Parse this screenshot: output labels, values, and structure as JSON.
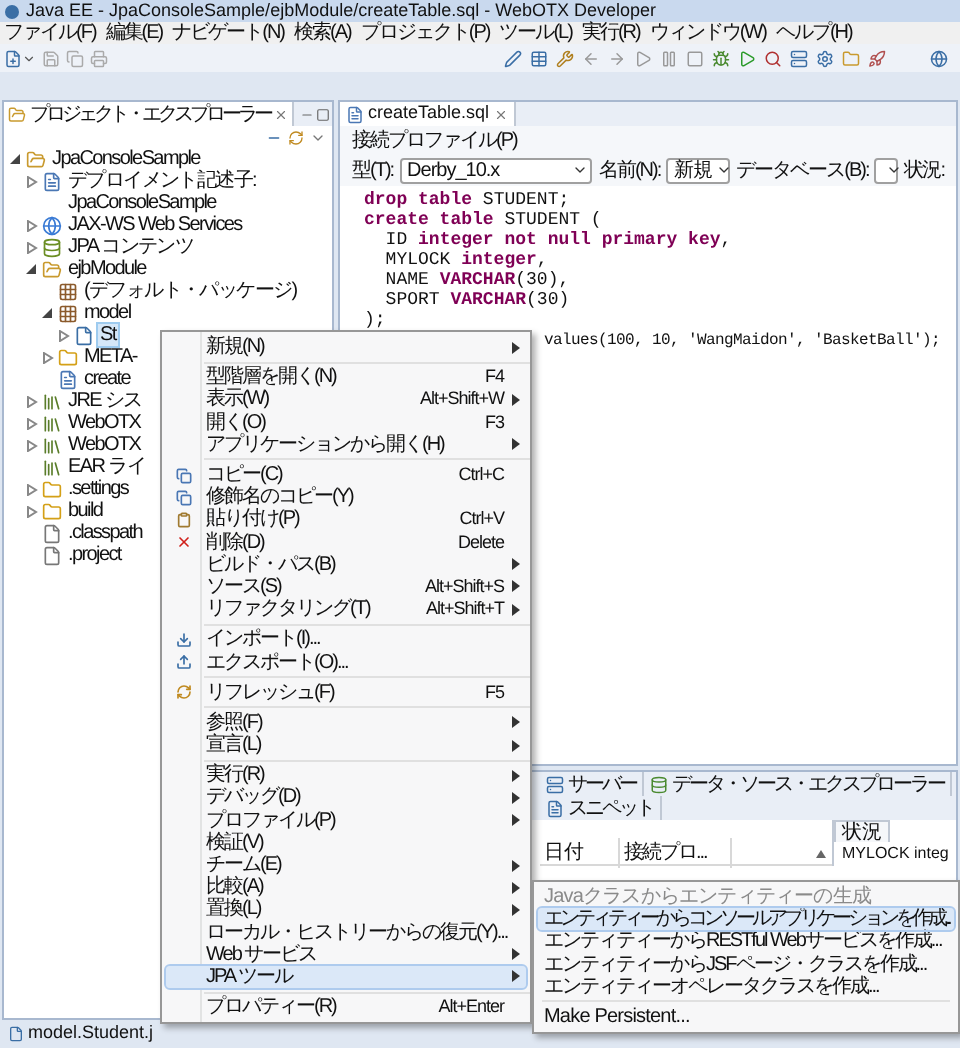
{
  "window": {
    "title": "Java EE - JpaConsoleSample/ejbModule/createTable.sql - WebOTX Developer"
  },
  "menu_bar": [
    "ファイル(F)",
    "編集(E)",
    "ナビゲート(N)",
    "検索(A)",
    "プロジェクト(P)",
    "ツール(L)",
    "実行(R)",
    "ウィンドウ(W)",
    "ヘルプ(H)"
  ],
  "explorer": {
    "title": "プロジェクト・エクスプローラー",
    "tree": [
      {
        "label": "JpaConsoleSample",
        "kind": "project",
        "expanded": true,
        "selected": false,
        "children": [
          {
            "label": "デプロイメント記述子: JpaConsoleSample",
            "kind": "descriptor",
            "expanded": false,
            "selected": false
          },
          {
            "label": "JAX-WS Web Services",
            "kind": "webservice",
            "expanded": false,
            "selected": false
          },
          {
            "label": "JPA コンテンツ",
            "kind": "jpa",
            "expanded": false,
            "selected": false
          },
          {
            "label": "ejbModule",
            "kind": "srcfolder",
            "expanded": true,
            "selected": false,
            "children": [
              {
                "label": "(デフォルト・パッケージ)",
                "kind": "package",
                "selected": false
              },
              {
                "label": "model",
                "kind": "package",
                "expanded": true,
                "selected": false,
                "children": [
                  {
                    "label": "St",
                    "kind": "java",
                    "expanded": false,
                    "selected": true
                  }
                ]
              },
              {
                "label": "META-",
                "kind": "folder",
                "expanded": false,
                "selected": false
              },
              {
                "label": "create",
                "kind": "sqlfile",
                "selected": false
              }
            ]
          },
          {
            "label": "JRE シス",
            "kind": "library",
            "expanded": false,
            "selected": false
          },
          {
            "label": "WebOTX",
            "kind": "library",
            "expanded": false,
            "selected": false
          },
          {
            "label": "WebOTX",
            "kind": "library",
            "expanded": false,
            "selected": false
          },
          {
            "label": "EAR ライ",
            "kind": "library",
            "selected": false
          },
          {
            "label": ".settings",
            "kind": "folder",
            "expanded": false,
            "selected": false
          },
          {
            "label": "build",
            "kind": "folder",
            "expanded": false,
            "selected": false
          },
          {
            "label": ".classpath",
            "kind": "file",
            "selected": false
          },
          {
            "label": ".project",
            "kind": "file",
            "selected": false
          }
        ]
      }
    ]
  },
  "editor": {
    "tab": "createTable.sql",
    "connection_label": "接続プロファイル(P)",
    "type_label": "型(T):",
    "type_value": "Derby_10.x",
    "name_label": "名前(N):",
    "name_value": "新規",
    "database_label": "データベース(B):",
    "status_label": "状況:",
    "lines": [
      "**drop table** STUDENT;",
      "**create table** STUDENT (",
      "  ID **integer not null primary key**,",
      "  MYLOCK **integer**,",
      "  NAME **VARCHAR**(30),",
      "  SPORT **VARCHAR**(30)",
      ");"
    ],
    "cut_line": "values(100, 10, 'WangMaidon', 'BasketBall');"
  },
  "bottom_panel": {
    "tabs": [
      "サーバー",
      "データ・ソース・エクスプローラー",
      "スニペット"
    ],
    "columns": [
      "日付",
      "接続プロ..."
    ],
    "side_tab": "状況",
    "side_text": "MYLOCK integ"
  },
  "context_menu": {
    "groups": [
      [
        {
          "label": "新規(N)",
          "kind": "plain",
          "submenu": true,
          "selected": false
        }
      ],
      [
        {
          "label": "型階層を開く(N)",
          "kind": "plain",
          "shortcut": "F4",
          "submenu": false,
          "selected": false
        },
        {
          "label": "表示(W)",
          "kind": "plain",
          "shortcut": "Alt+Shift+W",
          "submenu": true,
          "selected": false
        },
        {
          "label": "開く(O)",
          "kind": "plain",
          "shortcut": "F3",
          "submenu": false,
          "selected": false
        },
        {
          "label": "アプリケーションから開く(H)",
          "kind": "plain",
          "submenu": true,
          "selected": false
        }
      ],
      [
        {
          "label": "コピー(C)",
          "kind": "copy",
          "shortcut": "Ctrl+C",
          "submenu": false,
          "selected": false
        },
        {
          "label": "修飾名のコピー(Y)",
          "kind": "copy",
          "submenu": false,
          "selected": false
        },
        {
          "label": "貼り付け(P)",
          "kind": "paste",
          "shortcut": "Ctrl+V",
          "submenu": false,
          "selected": false
        },
        {
          "label": "削除(D)",
          "kind": "delete",
          "shortcut": "Delete",
          "submenu": false,
          "selected": false
        },
        {
          "label": "ビルド・パス(B)",
          "kind": "plain",
          "submenu": true,
          "selected": false
        },
        {
          "label": "ソース(S)",
          "kind": "plain",
          "shortcut": "Alt+Shift+S",
          "submenu": true,
          "selected": false
        },
        {
          "label": "リファクタリング(T)",
          "kind": "plain",
          "shortcut": "Alt+Shift+T",
          "submenu": true,
          "selected": false
        }
      ],
      [
        {
          "label": "インポート(I)...",
          "kind": "import",
          "submenu": false,
          "selected": false
        },
        {
          "label": "エクスポート(O)...",
          "kind": "export",
          "submenu": false,
          "selected": false
        }
      ],
      [
        {
          "label": "リフレッシュ(F)",
          "kind": "refresh",
          "shortcut": "F5",
          "submenu": false,
          "selected": false
        }
      ],
      [
        {
          "label": "参照(F)",
          "kind": "plain",
          "submenu": true,
          "selected": false
        },
        {
          "label": "宣言(L)",
          "kind": "plain",
          "submenu": true,
          "selected": false
        }
      ],
      [
        {
          "label": "実行(R)",
          "kind": "plain",
          "submenu": true,
          "selected": false
        },
        {
          "label": "デバッグ(D)",
          "kind": "plain",
          "submenu": true,
          "selected": false
        },
        {
          "label": "プロファイル(P)",
          "kind": "plain",
          "submenu": true,
          "selected": false
        },
        {
          "label": "検証(V)",
          "kind": "plain",
          "submenu": false,
          "selected": false
        },
        {
          "label": "チーム(E)",
          "kind": "plain",
          "submenu": true,
          "selected": false
        },
        {
          "label": "比較(A)",
          "kind": "plain",
          "submenu": true,
          "selected": false
        },
        {
          "label": "置換(L)",
          "kind": "plain",
          "submenu": true,
          "selected": false
        },
        {
          "label": "ローカル・ヒストリーからの復元(Y)...",
          "kind": "plain",
          "submenu": false,
          "selected": false
        },
        {
          "label": "Web サービス",
          "kind": "plain",
          "submenu": true,
          "selected": false
        },
        {
          "label": "JPA ツール",
          "kind": "plain",
          "submenu": true,
          "selected": true
        }
      ],
      [
        {
          "label": "プロパティー(R)",
          "kind": "plain",
          "shortcut": "Alt+Enter",
          "submenu": false,
          "selected": false
        }
      ]
    ]
  },
  "submenu": {
    "groups": [
      [
        {
          "label": "Javaクラスからエンティティーの生成",
          "disabled": true,
          "selected": false
        },
        {
          "label": "エンティティーからコンソールアプリケーションを作成...",
          "disabled": false,
          "selected": true
        },
        {
          "label": "エンティティーからRESTful Webサービスを作成...",
          "disabled": false,
          "selected": false
        },
        {
          "label": "エンティティーからJSFページ・クラスを作成...",
          "disabled": false,
          "selected": false
        },
        {
          "label": "エンティティーオペレータクラスを作成...",
          "disabled": false,
          "selected": false
        }
      ],
      [
        {
          "label": "Make Persistent...",
          "disabled": false,
          "selected": false
        }
      ]
    ]
  },
  "status_bar": "model.Student.j"
}
